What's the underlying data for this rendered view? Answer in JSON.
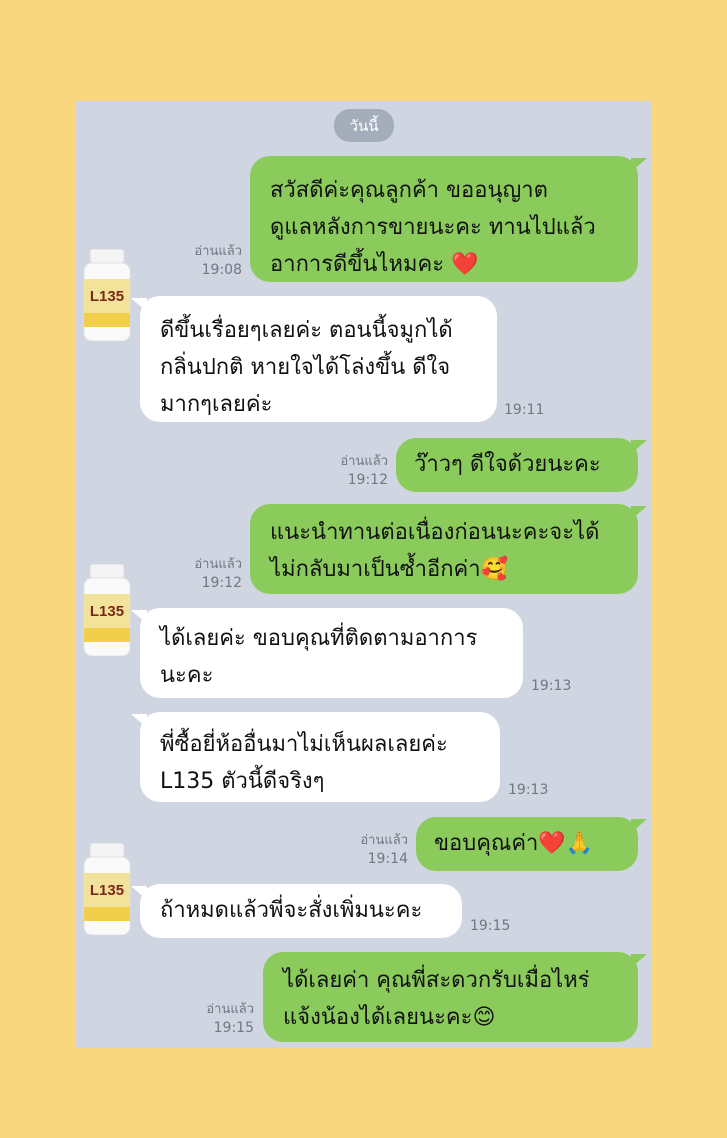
{
  "date_label": "วันนี้",
  "read_label": "อ่านแล้ว",
  "avatar_label": "L135",
  "messages": [
    {
      "text": "สวัสดีค่ะคุณลูกค้า  ขออนุญาต\nดูแลหลังการขายนะคะ ทานไปแล้ว\nอาการดีขึ้นไหมคะ ❤️",
      "time": "19:08"
    },
    {
      "text": "ดีขึ้นเรื่อยๆเลยค่ะ ตอนนี้จมูกได้\nกลิ่นปกติ หายใจได้โล่งขึ้น ดีใจ\nมากๆเลยค่ะ",
      "time": "19:11"
    },
    {
      "text": "ว๊าวๆ ดีใจด้วยนะคะ",
      "time": "19:12"
    },
    {
      "text": "แนะนำทานต่อเนื่องก่อนนะคะจะได้\nไม่กลับมาเป็นซ้ำอีกค่า🥰",
      "time": "19:12"
    },
    {
      "text": "ได้เลยค่ะ ขอบคุณที่ติดตามอาการ\nนะคะ",
      "time": "19:13"
    },
    {
      "text": "พี่ซื้อยี่ห้ออื่นมาไม่เห็นผลเลยค่ะ\nL135 ตัวนี้ดีจริงๆ",
      "time": "19:13"
    },
    {
      "text": "ขอบคุณค่า❤️🙏",
      "time": "19:14"
    },
    {
      "text": "ถ้าหมดแล้วพี่จะสั่งเพิ่มนะคะ",
      "time": "19:15"
    },
    {
      "text": "ได้เลยค่า คุณพี่สะดวกรับเมื่อไหร่\nแจ้งน้องได้เลยนะคะ😊",
      "time": "19:15"
    }
  ]
}
